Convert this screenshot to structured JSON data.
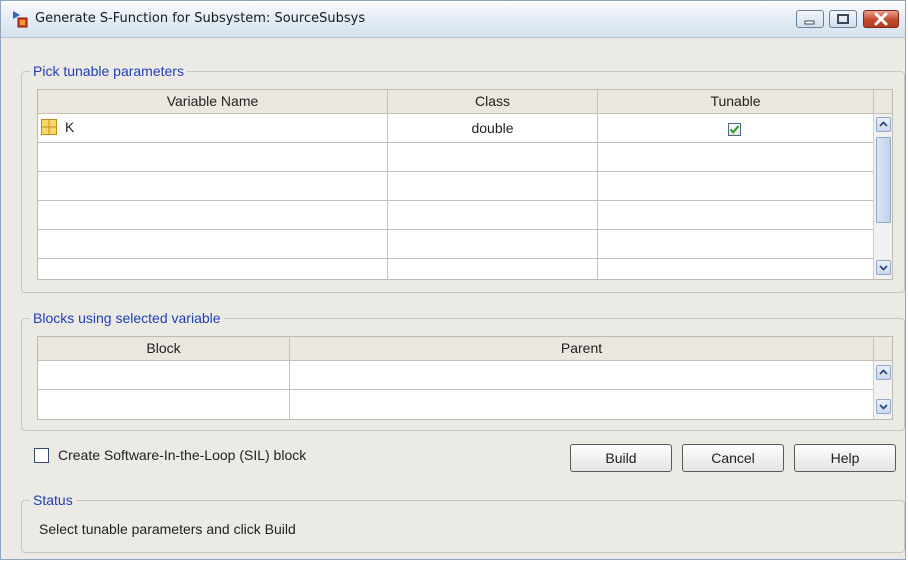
{
  "window": {
    "title": "Generate S-Function for Subsystem: SourceSubsys"
  },
  "tunable_group": {
    "title": "Pick tunable parameters",
    "columns": [
      "Variable Name",
      "Class",
      "Tunable"
    ],
    "rows": [
      {
        "name": "K",
        "class": "double",
        "tunable": true
      }
    ]
  },
  "blocks_group": {
    "title": "Blocks using selected variable",
    "columns": [
      "Block",
      "Parent"
    ]
  },
  "sil_checkbox": {
    "label": "Create Software-In-the-Loop (SIL) block",
    "checked": false
  },
  "buttons": {
    "build": "Build",
    "cancel": "Cancel",
    "help": "Help"
  },
  "status": {
    "title": "Status",
    "text": "Select tunable parameters and click Build"
  },
  "colors": {
    "group_title": "#1f3fb8",
    "check_mark": "#2a9a2a",
    "close_button": "#c44a2e"
  }
}
